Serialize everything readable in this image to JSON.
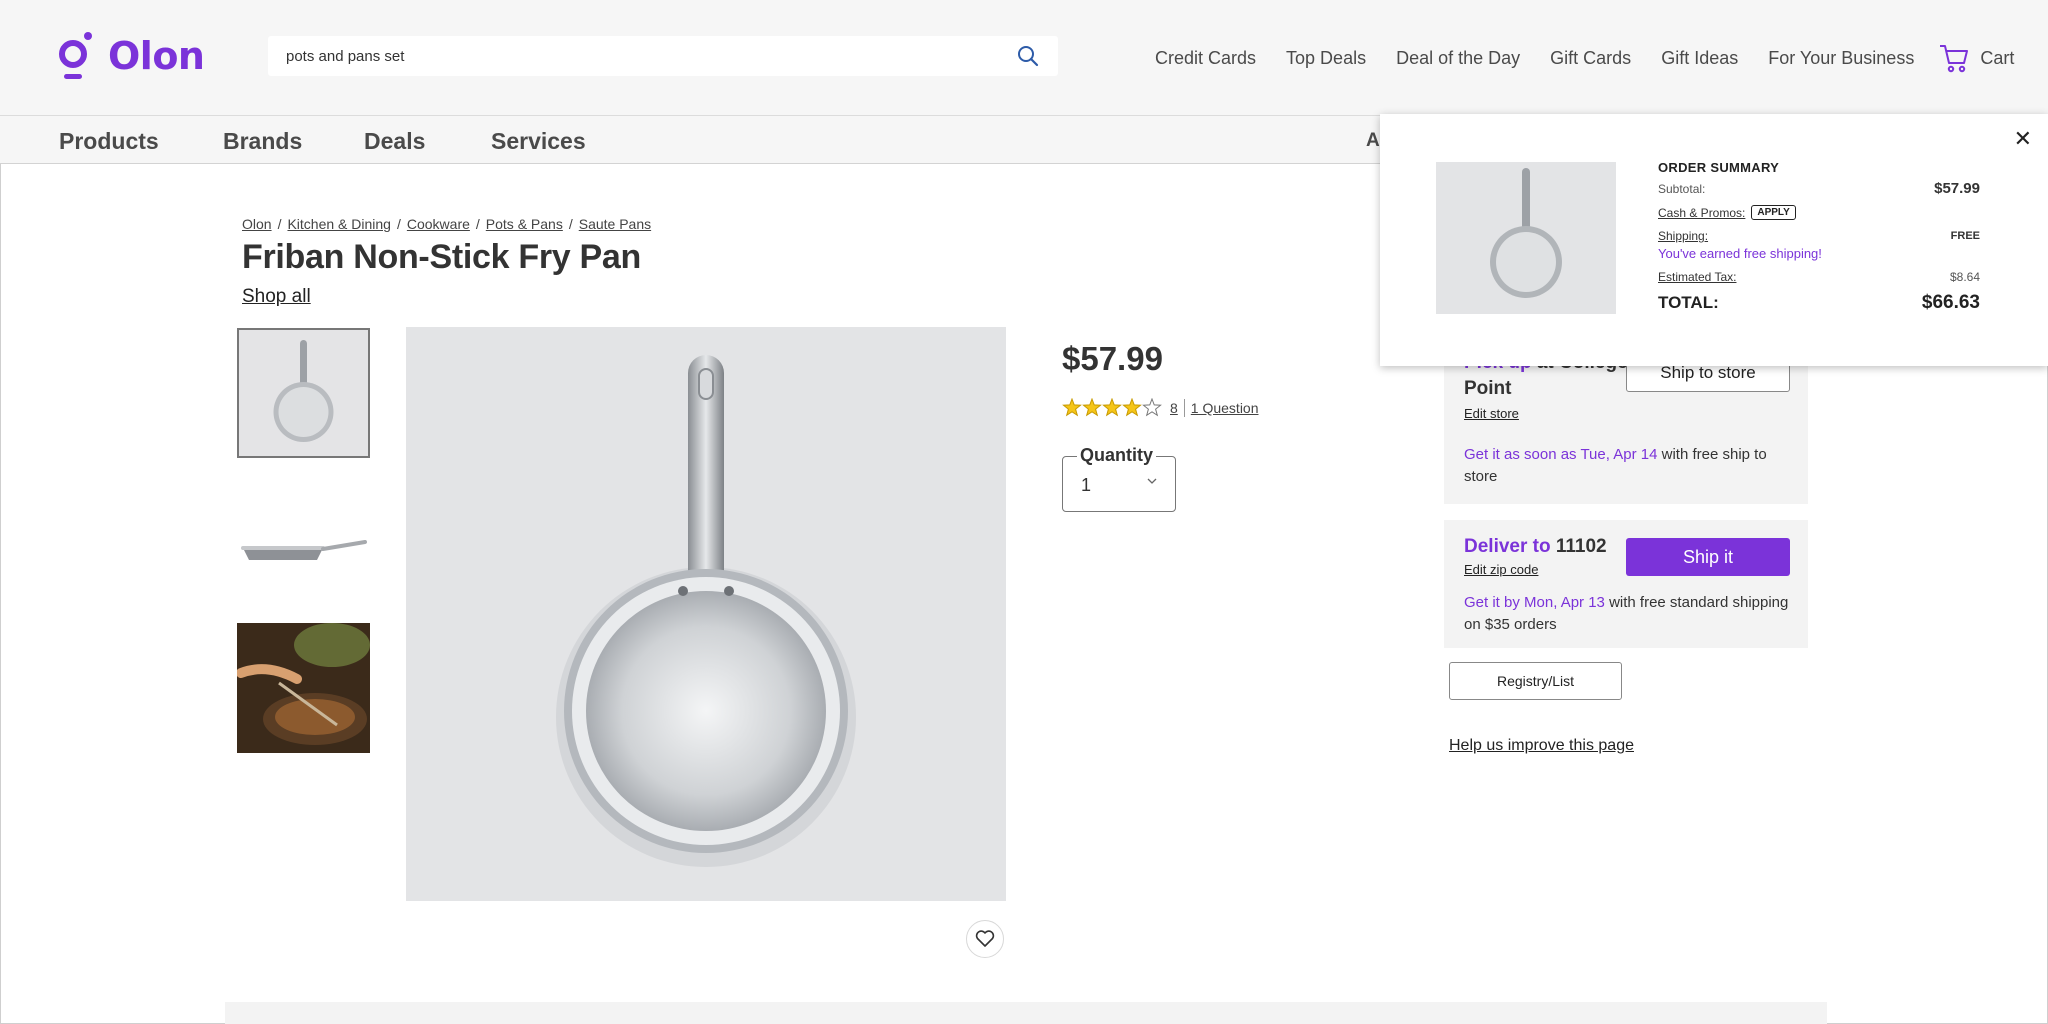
{
  "brand": {
    "name": "Olon",
    "color": "#7b33d9"
  },
  "search": {
    "value": "pots and pans set",
    "icon": "search-icon"
  },
  "topnav": [
    "Credit Cards",
    "Top Deals",
    "Deal of the Day",
    "Gift Cards",
    "Gift Ideas",
    "For Your Business"
  ],
  "cart": {
    "label": "Cart",
    "icon": "cart-icon"
  },
  "categories": [
    "Products",
    "Brands",
    "Deals",
    "Services"
  ],
  "catbar_truncated": "Ac",
  "breadcrumb": [
    "Olon",
    "Kitchen & Dining",
    "Cookware",
    "Pots & Pans",
    "Saute Pans"
  ],
  "product": {
    "title": "Friban Non-Stick Fry Pan",
    "shop_all": "Shop all",
    "price": "$57.99",
    "rating_value": 4,
    "rating_max": 5,
    "review_count": "8",
    "questions": "1 Question",
    "quantity_label": "Quantity",
    "quantity": "1"
  },
  "pickup": {
    "heading_prefix": "Pick up",
    "heading_rest": " at College Point",
    "edit": "Edit store",
    "msg_highlight": "Get it as soon as Tue, Apr 14",
    "msg_rest": " with free ship to store",
    "button": "Ship to store"
  },
  "ship": {
    "heading_prefix": "Deliver to",
    "zip": "11102",
    "edit": "Edit zip code",
    "button": "Ship it",
    "msg_highlight": "Get it by Mon, Apr 13",
    "msg_rest": " with free standard shipping on $35 orders"
  },
  "registry": "Registry/List",
  "help": "Help us improve this page",
  "summary": {
    "title": "ORDER SUMMARY",
    "subtotal_label": "Subtotal:",
    "subtotal": "$57.99",
    "promos_label": "Cash & Promos:",
    "apply": "APPLY",
    "shipping_label": "Shipping:",
    "shipping": "FREE",
    "free_msg": "You've earned free shipping!",
    "tax_label": "Estimated Tax:",
    "tax": "$8.64",
    "total_label": "TOTAL:",
    "total": "$66.63",
    "close": "✕"
  }
}
